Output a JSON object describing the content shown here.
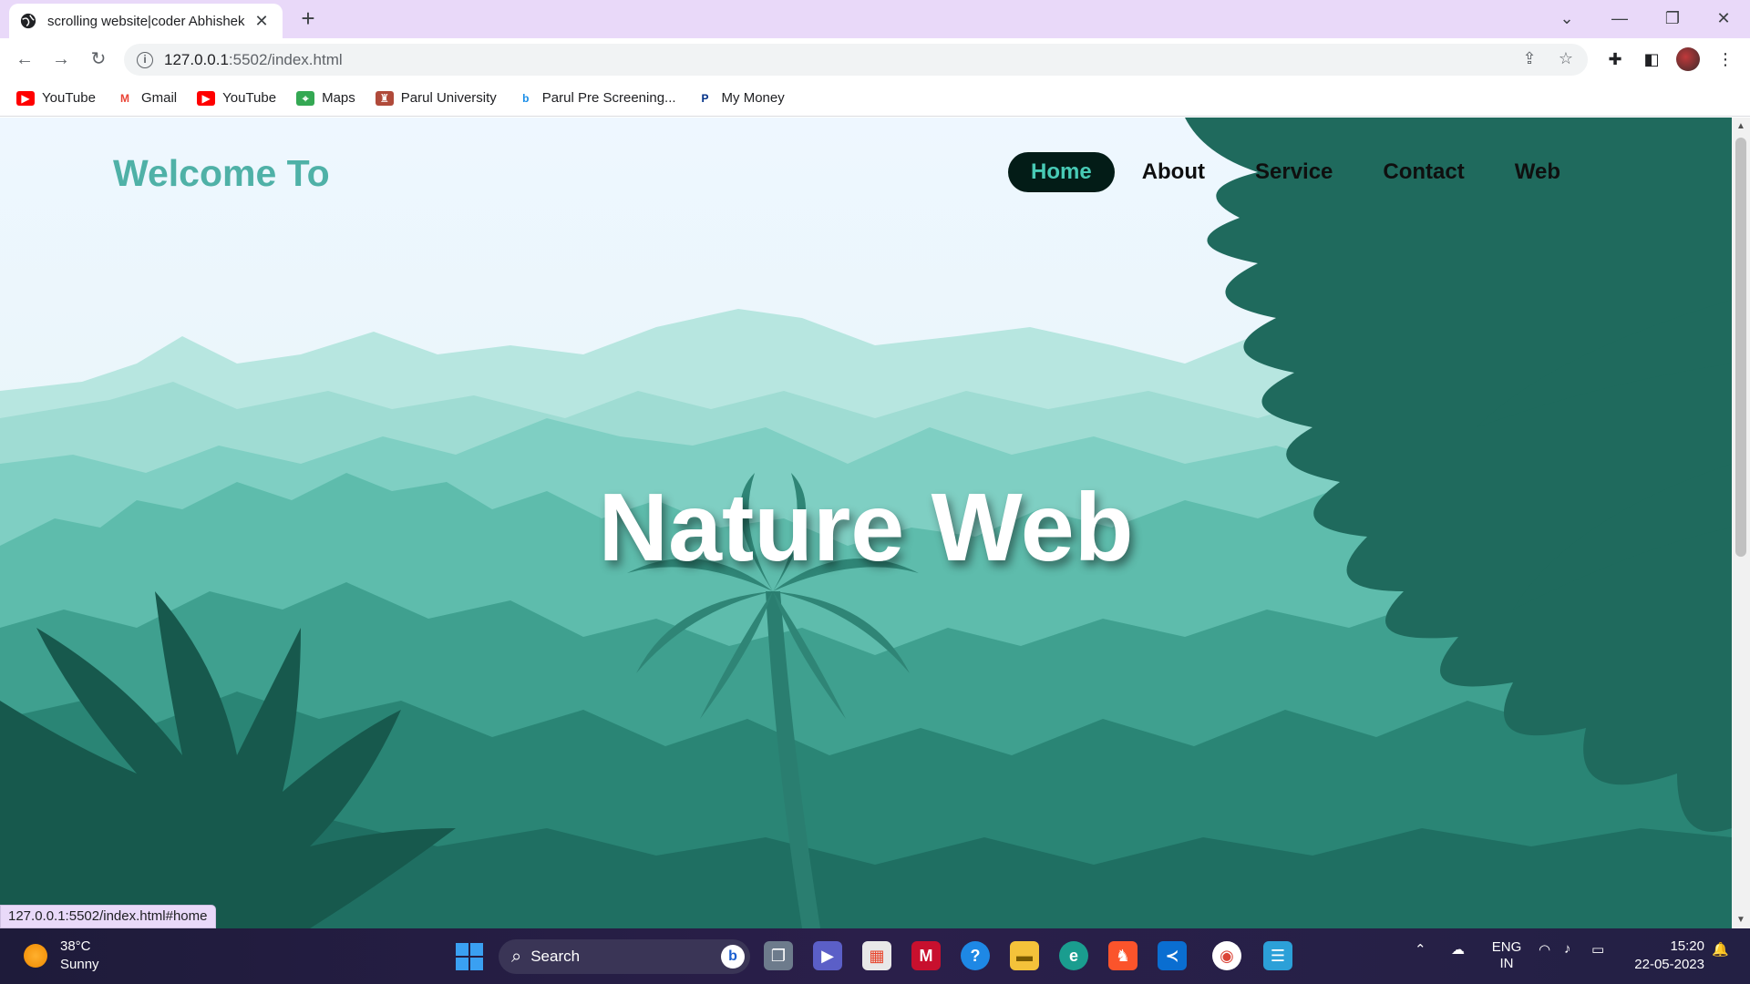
{
  "browser": {
    "tab_title": "scrolling website|coder Abhishek",
    "url_host": "127.0.0.1",
    "url_path": ":5502/index.html",
    "status_url": "127.0.0.1:5502/index.html#home"
  },
  "bookmarks": [
    {
      "label": "YouTube",
      "icon": "youtube-icon",
      "color": "#ff0000"
    },
    {
      "label": "Gmail",
      "icon": "gmail-icon",
      "color": "#ea4335"
    },
    {
      "label": "YouTube",
      "icon": "youtube-icon",
      "color": "#ff0000"
    },
    {
      "label": "Maps",
      "icon": "maps-icon",
      "color": "#34a853"
    },
    {
      "label": "Parul University",
      "icon": "parul-university-icon",
      "color": "#b04a3a"
    },
    {
      "label": "Parul Pre Screening...",
      "icon": "bing-icon",
      "color": "#1a8ee8"
    },
    {
      "label": "My Money",
      "icon": "paypal-icon",
      "color": "#003087"
    }
  ],
  "page": {
    "logo": "Welcome To",
    "nav": [
      {
        "label": "Home",
        "active": true
      },
      {
        "label": "About",
        "active": false
      },
      {
        "label": "Service",
        "active": false
      },
      {
        "label": "Contact",
        "active": false
      },
      {
        "label": "Web",
        "active": false
      }
    ],
    "hero_title": "Nature Web"
  },
  "taskbar": {
    "weather_temp": "38°C",
    "weather_desc": "Sunny",
    "search_placeholder": "Search",
    "lang": "ENG",
    "region": "IN",
    "time": "15:20",
    "date": "22-05-2023"
  },
  "colors": {
    "accent": "#4fb1a7",
    "nav_active_bg": "#031c17",
    "nav_active_text": "#48cab5",
    "tabbar": "#e9d9f9"
  }
}
